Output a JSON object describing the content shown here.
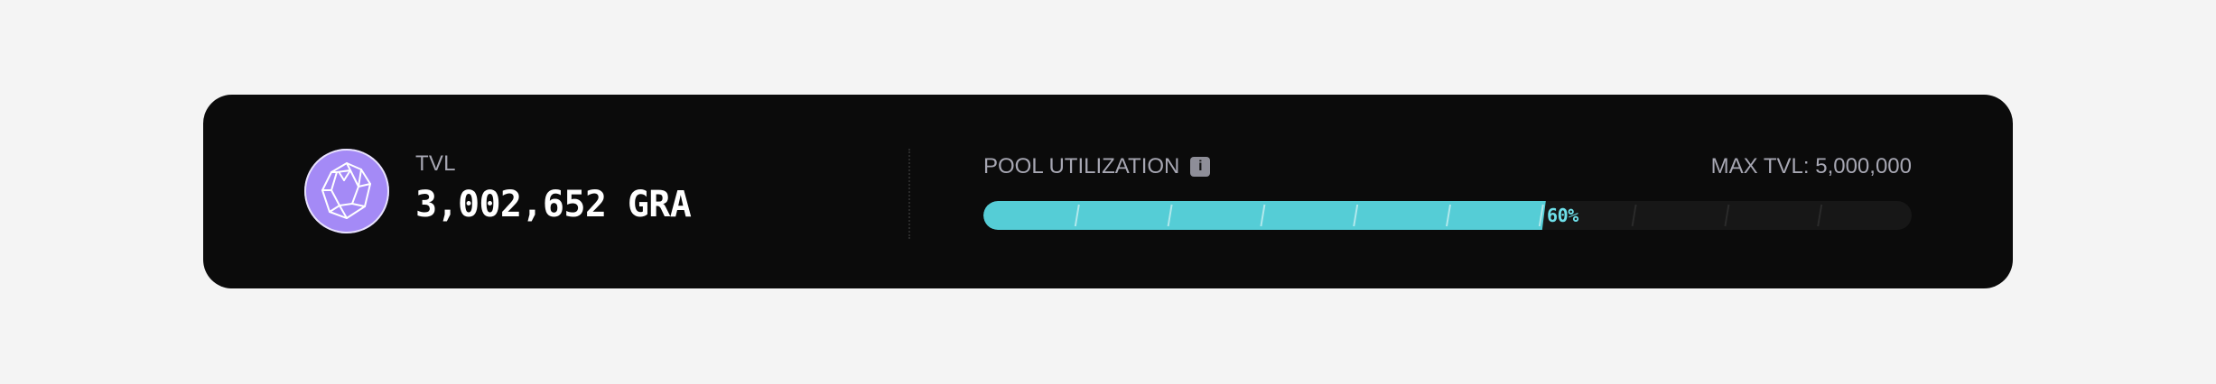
{
  "tvl": {
    "label": "TVL",
    "value": "3,002,652 GRA",
    "token_icon": "diamond-icon"
  },
  "utilization": {
    "label": "POOL UTILIZATION",
    "info_icon": "info-icon",
    "info_glyph": "i",
    "max_tvl_text": "MAX TVL: 5,000,000",
    "percent_text": "60%",
    "progress": 0.6
  },
  "colors": {
    "card_background": "#0b0b0b",
    "page_background": "#f4f4f4",
    "progress_fill": "#55cdd6",
    "progress_track": "#171717",
    "token_icon_background": "#a48af6",
    "secondary_text": "#a7a7b3",
    "progress_text": "#6fe0ea"
  }
}
